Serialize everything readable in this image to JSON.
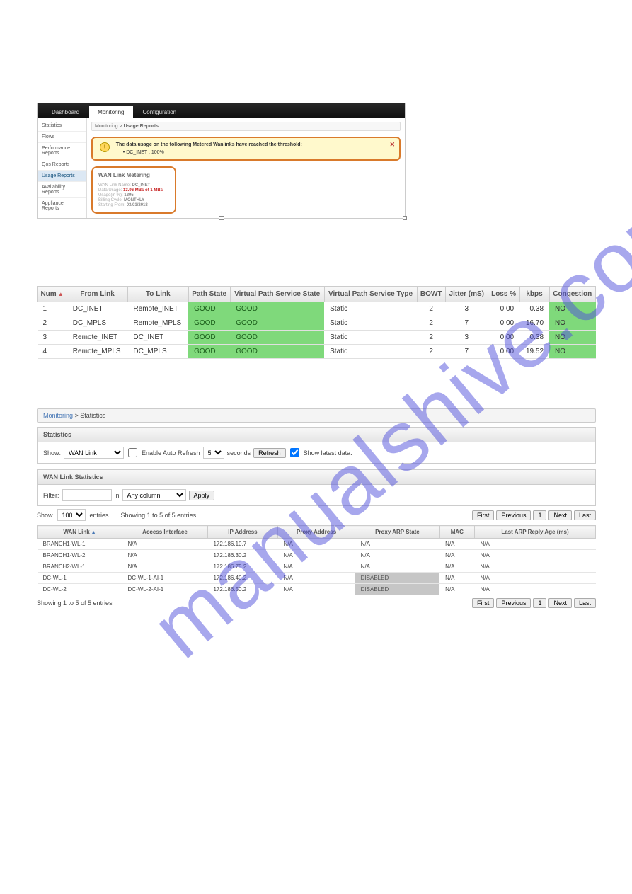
{
  "watermark": "manualshive.com",
  "s1": {
    "tabs": {
      "dashboard": "Dashboard",
      "monitoring": "Monitoring",
      "configuration": "Configuration"
    },
    "side": {
      "statistics": "Statistics",
      "flows": "Flows",
      "perf": "Performance Reports",
      "qos": "Qos Reports",
      "usage": "Usage Reports",
      "avail": "Availability Reports",
      "appliance": "Appliance Reports"
    },
    "crumb_monitoring": "Monitoring",
    "crumb_sep": " > ",
    "crumb_usage": "Usage Reports",
    "alert": {
      "title": "The data usage on the following Metered Wanlinks have reached the threshold:",
      "item": "DC_INET : 100%"
    },
    "meter": {
      "title": "WAN Link Metering",
      "name_lbl": "WAN Link Name:",
      "name_val": "DC_INET",
      "usage_lbl": "Data Usage:",
      "usage_val": "13.96 MBs of 1 MBs",
      "pct_lbl": "Usage(in %):",
      "pct_val": "1395",
      "cycle_lbl": "Billing Cycle:",
      "cycle_val": "MONTHLY",
      "from_lbl": "Starting From:",
      "from_val": "03/01/2018"
    }
  },
  "vp": {
    "headers": {
      "num": "Num",
      "from": "From Link",
      "to": "To Link",
      "path": "Path State",
      "vps_state": "Virtual Path Service State",
      "vps_type": "Virtual Path Service Type",
      "bowt": "BOWT",
      "jitter": "Jitter (mS)",
      "loss": "Loss %",
      "kbps": "kbps",
      "cong": "Congestion"
    },
    "rows": [
      {
        "num": "1",
        "from": "DC_INET",
        "to": "Remote_INET",
        "path": "GOOD",
        "vstate": "GOOD",
        "vtype": "Static",
        "bowt": "2",
        "jitter": "3",
        "loss": "0.00",
        "kbps": "0.38",
        "cong": "NO"
      },
      {
        "num": "2",
        "from": "DC_MPLS",
        "to": "Remote_MPLS",
        "path": "GOOD",
        "vstate": "GOOD",
        "vtype": "Static",
        "bowt": "2",
        "jitter": "7",
        "loss": "0.00",
        "kbps": "16.70",
        "cong": "NO"
      },
      {
        "num": "3",
        "from": "Remote_INET",
        "to": "DC_INET",
        "path": "GOOD",
        "vstate": "GOOD",
        "vtype": "Static",
        "bowt": "2",
        "jitter": "3",
        "loss": "0.00",
        "kbps": "0.38",
        "cong": "NO"
      },
      {
        "num": "4",
        "from": "Remote_MPLS",
        "to": "DC_MPLS",
        "path": "GOOD",
        "vstate": "GOOD",
        "vtype": "Static",
        "bowt": "2",
        "jitter": "7",
        "loss": "0.00",
        "kbps": "19.52",
        "cong": "NO"
      }
    ]
  },
  "stats": {
    "crumb_monitoring": "Monitoring",
    "crumb_sep": " > ",
    "crumb_stats": "Statistics",
    "hdr": "Statistics",
    "show_lbl": "Show:",
    "show_sel": "WAN Link",
    "auto_lbl": "Enable Auto Refresh",
    "refresh_val": "5",
    "seconds": "seconds",
    "refresh_btn": "Refresh",
    "latest": "Show latest data.",
    "sub_hdr": "WAN Link Statistics",
    "filter_lbl": "Filter:",
    "in_lbl": "in",
    "anycol": "Any column",
    "apply": "Apply",
    "show100_lbl": "Show",
    "show100_val": "100",
    "entries_lbl": "entries",
    "showing": "Showing 1 to 5 of 5 entries",
    "pager": {
      "first": "First",
      "prev": "Previous",
      "one": "1",
      "next": "Next",
      "last": "Last"
    },
    "cols": {
      "wan": "WAN Link",
      "iface": "Access Interface",
      "ip": "IP Address",
      "proxy": "Proxy Address",
      "arp": "Proxy ARP State",
      "mac": "MAC",
      "age": "Last ARP Reply Age (ms)"
    },
    "rows": [
      {
        "wan": "BRANCH1-WL-1",
        "iface": "N/A",
        "ip": "172.186.10.7",
        "proxy": "N/A",
        "arp": "N/A",
        "mac": "N/A",
        "age": "N/A",
        "disabled": false
      },
      {
        "wan": "BRANCH1-WL-2",
        "iface": "N/A",
        "ip": "172.186.30.2",
        "proxy": "N/A",
        "arp": "N/A",
        "mac": "N/A",
        "age": "N/A",
        "disabled": false
      },
      {
        "wan": "BRANCH2-WL-1",
        "iface": "N/A",
        "ip": "172.186.75.2",
        "proxy": "N/A",
        "arp": "N/A",
        "mac": "N/A",
        "age": "N/A",
        "disabled": false
      },
      {
        "wan": "DC-WL-1",
        "iface": "DC-WL-1-AI-1",
        "ip": "172.186.40.2",
        "proxy": "N/A",
        "arp": "DISABLED",
        "mac": "N/A",
        "age": "N/A",
        "disabled": true
      },
      {
        "wan": "DC-WL-2",
        "iface": "DC-WL-2-AI-1",
        "ip": "172.186.50.2",
        "proxy": "N/A",
        "arp": "DISABLED",
        "mac": "N/A",
        "age": "N/A",
        "disabled": true
      }
    ]
  }
}
